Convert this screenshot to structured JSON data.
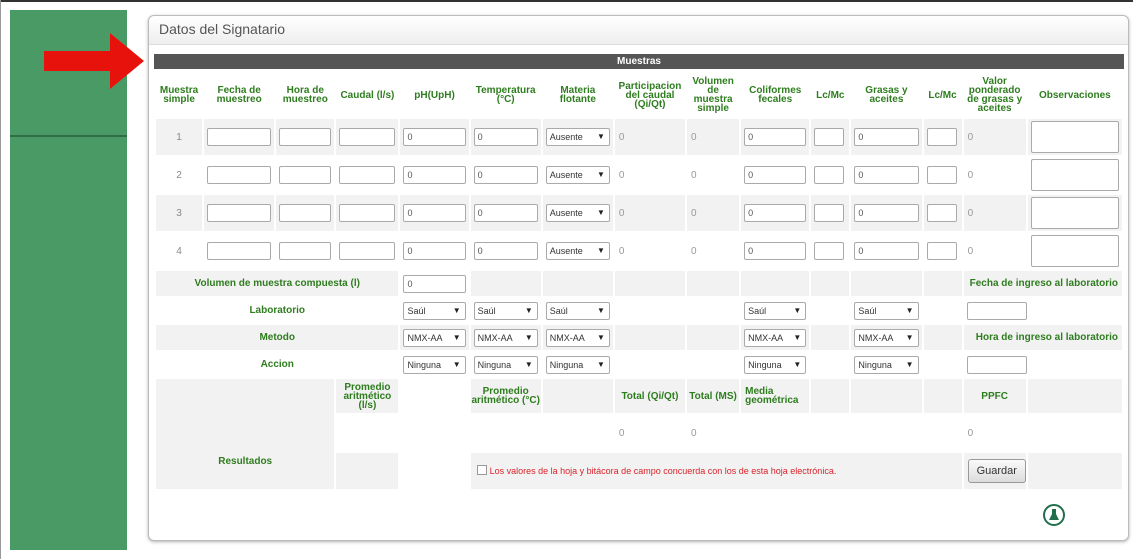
{
  "panel": {
    "title": "Datos del Signatario"
  },
  "section_bar": "Muestras",
  "headers": [
    "Muestra simple",
    "Fecha de muestreo",
    "Hora de muestreo",
    "Caudal (l/s)",
    "pH(UpH)",
    "Temperatura (°C)",
    "Materia flotante",
    "Participacion del caudal (Qi/Qt)",
    "Volumen de muestra simple",
    "Coliformes fecales",
    "Lc/Mc",
    "Grasas y aceites",
    "Lc/Mc",
    "Valor ponderado de grasas y aceites",
    "Observaciones"
  ],
  "rows": [
    {
      "num": "1",
      "ph": "0",
      "temp": "0",
      "materia": "Ausente",
      "part": "0",
      "vol": "0",
      "colif": "0",
      "grasas": "0",
      "valor": "0"
    },
    {
      "num": "2",
      "ph": "0",
      "temp": "0",
      "materia": "Ausente",
      "part": "0",
      "vol": "0",
      "colif": "0",
      "grasas": "0",
      "valor": "0"
    },
    {
      "num": "3",
      "ph": "0",
      "temp": "0",
      "materia": "Ausente",
      "part": "0",
      "vol": "0",
      "colif": "0",
      "grasas": "0",
      "valor": "0"
    },
    {
      "num": "4",
      "ph": "0",
      "temp": "0",
      "materia": "Ausente",
      "part": "0",
      "vol": "0",
      "colif": "0",
      "grasas": "0",
      "valor": "0"
    }
  ],
  "volumen": {
    "label": "Volumen de muestra compuesta (l)",
    "value": "0"
  },
  "fecha_ingreso_label": "Fecha de ingreso al laboratorio",
  "hora_ingreso_label": "Hora de ingreso al laboratorio",
  "laboratorio": {
    "label": "Laboratorio",
    "value": "Saúl"
  },
  "metodo": {
    "label": "Metodo",
    "value": "NMX-AA"
  },
  "accion": {
    "label": "Accion",
    "value": "Ninguna"
  },
  "resultados": {
    "label": "Resultados",
    "promedio_caudal": "Promedio aritmético (l/s)",
    "promedio_temp": "Promedio aritmético (°C)",
    "total_qi": "Total (Qi/Qt)",
    "total_ms": "Total (MS)",
    "media_geo": "Media geométrica",
    "ppfc": "PPFC",
    "total_qi_value": "0",
    "total_ms_value": "0",
    "ppfc_value": "0"
  },
  "confirm_text": "Los valores de la hoja y bitácora de campo concuerda con los de esta hoja electrónica.",
  "save_button": "Guardar",
  "colors": {
    "sidebar": "#4a9a66",
    "header_green": "#2e7d1e",
    "arrow": "#e8120c",
    "bar": "#555555",
    "notice": "#d9232a"
  },
  "icons": {
    "arrow": "red-arrow-icon",
    "flask": "flask-icon"
  }
}
